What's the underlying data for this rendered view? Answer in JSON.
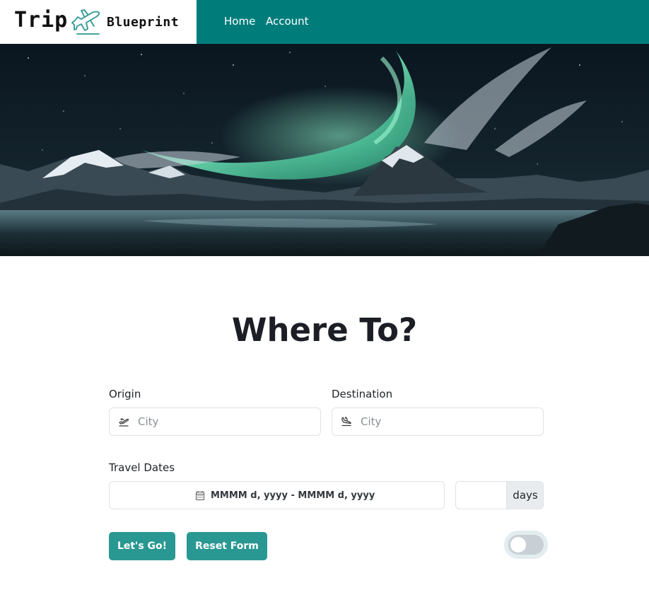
{
  "brand": {
    "name_part1": "Trip",
    "name_part2": "Blueprint",
    "logo_icon": "airplane-icon"
  },
  "nav": {
    "home": "Home",
    "account": "Account"
  },
  "hero": {
    "image": "aurora-mountains-landscape"
  },
  "form": {
    "title": "Where To?",
    "origin": {
      "label": "Origin",
      "placeholder": "City",
      "value": "",
      "icon": "airplane-departure-icon"
    },
    "destination": {
      "label": "Destination",
      "placeholder": "City",
      "value": "",
      "icon": "airplane-arrival-icon"
    },
    "dates": {
      "label": "Travel Dates",
      "value": "MMMM d, yyyy - MMMM d, yyyy",
      "icon": "calendar-icon"
    },
    "days": {
      "value": "",
      "addon": "days"
    },
    "buttons": {
      "submit": "Let's Go!",
      "reset": "Reset Form"
    },
    "toggle": {
      "checked": false
    }
  },
  "colors": {
    "header": "#007d7b",
    "button": "#2a9892",
    "title": "#1b1e24"
  }
}
